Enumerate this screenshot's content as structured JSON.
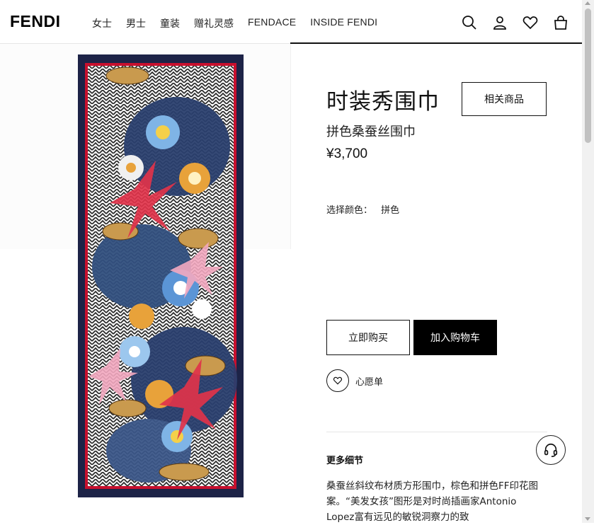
{
  "header": {
    "logo": "FENDI",
    "nav": [
      {
        "label": "女士",
        "key": "women"
      },
      {
        "label": "男士",
        "key": "men"
      },
      {
        "label": "童装",
        "key": "kids"
      },
      {
        "label": "赠礼灵感",
        "key": "gifts"
      },
      {
        "label": "FENDACE",
        "key": "fendace"
      },
      {
        "label": "INSIDE FENDI",
        "key": "inside"
      }
    ],
    "icons": [
      "search-icon",
      "account-icon",
      "wishlist-heart-icon",
      "shopping-bag-icon"
    ]
  },
  "product": {
    "title": "时装秀围巾",
    "related_label": "相关商品",
    "subtitle": "拼色桑蚕丝围巾",
    "price": "¥3,700",
    "color_label": "选择颜色：",
    "color_value": "拼色",
    "buy_now_label": "立即购买",
    "add_to_cart_label": "加入购物车",
    "wishlist_label": "心愿单",
    "details_title": "更多细节",
    "details_text": "桑蚕丝斜纹布材质方形围巾，棕色和拼色FF印花图案。“美发女孩”图形是对时尚插画家Antonio Lopez富有远见的敏锐洞察力的致"
  },
  "colors": {
    "accent": "#000000",
    "scarf_border": "#1d2347",
    "scarf_red": "#c8102e"
  }
}
